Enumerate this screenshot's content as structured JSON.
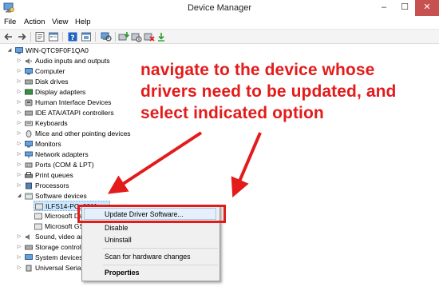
{
  "window": {
    "title": "Device Manager",
    "minimize": "–",
    "maximize": "☐",
    "close": "✕"
  },
  "menu": [
    "File",
    "Action",
    "View",
    "Help"
  ],
  "toolbar": {
    "icons": [
      "back-icon",
      "forward-icon",
      "properties-icon",
      "view-icon",
      "help-icon",
      "devices-icon",
      "scan-icon",
      "update-driver-icon",
      "uninstall-icon"
    ]
  },
  "tree": {
    "root": "WIN-QTC9F0F1QA0",
    "items": [
      "Audio inputs and outputs",
      "Computer",
      "Disk drives",
      "Display adapters",
      "Human Interface Devices",
      "IDE ATA/ATAPI controllers",
      "Keyboards",
      "Mice and other pointing devices",
      "Monitors",
      "Network adapters",
      "Ports (COM & LPT)",
      "Print queues",
      "Processors",
      "Software devices"
    ],
    "children": [
      "ILFS14-PC; 0011",
      "Microsoft Dev",
      "Microsoft GS"
    ],
    "after": [
      "Sound, video and",
      "Storage controlle",
      "System devices",
      "Universal Serial Bus"
    ]
  },
  "context_menu": {
    "items": [
      "Update Driver Software...",
      "Disable",
      "Uninstall",
      "Scan for hardware changes",
      "Properties"
    ]
  },
  "annotation": {
    "line1": "navigate to the device whose",
    "line2": "drivers need to be updated, and",
    "line3": "select indicated option"
  },
  "colors": {
    "annotation": "#e31b1b",
    "close_button": "#c75050",
    "highlight": "#e5f0fb"
  }
}
